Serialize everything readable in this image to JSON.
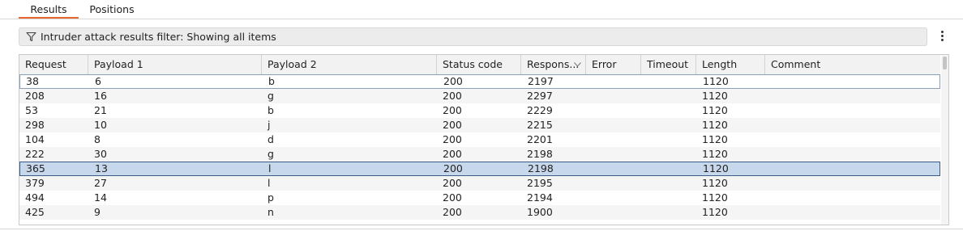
{
  "tabs": [
    {
      "label": "Results",
      "active": true
    },
    {
      "label": "Positions",
      "active": false
    }
  ],
  "filter": {
    "icon": "filter-icon",
    "text": "Intruder attack results filter: Showing all items"
  },
  "menu": {
    "icon": "kebab-menu-icon"
  },
  "table": {
    "columns": [
      "Request",
      "Payload 1",
      "Payload 2",
      "Status code",
      "Respons...",
      "Error",
      "Timeout",
      "Length",
      "Comment"
    ],
    "sorted_column": "Respons...",
    "sort_direction": "descending",
    "focused_row": 0,
    "selected_row": 6,
    "rows": [
      [
        "38",
        "6",
        "b",
        "200",
        "2197",
        "",
        "",
        "1120",
        ""
      ],
      [
        "208",
        "16",
        "g",
        "200",
        "2297",
        "",
        "",
        "1120",
        ""
      ],
      [
        "53",
        "21",
        "b",
        "200",
        "2229",
        "",
        "",
        "1120",
        ""
      ],
      [
        "298",
        "10",
        "j",
        "200",
        "2215",
        "",
        "",
        "1120",
        ""
      ],
      [
        "104",
        "8",
        "d",
        "200",
        "2201",
        "",
        "",
        "1120",
        ""
      ],
      [
        "222",
        "30",
        "g",
        "200",
        "2198",
        "",
        "",
        "1120",
        ""
      ],
      [
        "365",
        "13",
        "l",
        "200",
        "2198",
        "",
        "",
        "1120",
        ""
      ],
      [
        "379",
        "27",
        "l",
        "200",
        "2195",
        "",
        "",
        "1120",
        ""
      ],
      [
        "494",
        "14",
        "p",
        "200",
        "2194",
        "",
        "",
        "1120",
        ""
      ],
      [
        "425",
        "9",
        "n",
        "200",
        "1900",
        "",
        "",
        "1120",
        ""
      ]
    ]
  },
  "colors": {
    "accent": "#e8672f",
    "selected_row": "#c8d8ec",
    "selected_border": "#3c5a86"
  }
}
